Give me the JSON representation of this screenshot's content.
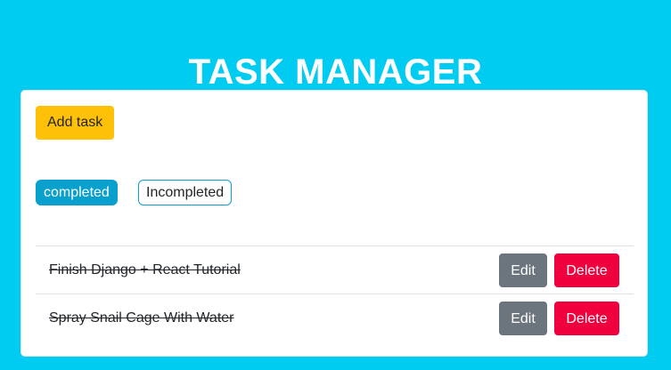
{
  "header": {
    "title": "TASK MANAGER"
  },
  "toolbar": {
    "add_label": "Add task"
  },
  "tabs": [
    {
      "label": "completed",
      "active": true
    },
    {
      "label": "Incompleted",
      "active": false
    }
  ],
  "tasks": [
    {
      "title": "Finish Django + React Tutorial",
      "completed": true,
      "edit_label": "Edit",
      "delete_label": "Delete"
    },
    {
      "title": "Spray Snail Cage With Water",
      "completed": true,
      "edit_label": "Edit",
      "delete_label": "Delete"
    }
  ],
  "colors": {
    "background": "#00ccf2",
    "add_button": "#ffc107",
    "tab_active": "#0aa0ce",
    "edit_button": "#6c757d",
    "delete_button": "#f0003c"
  }
}
